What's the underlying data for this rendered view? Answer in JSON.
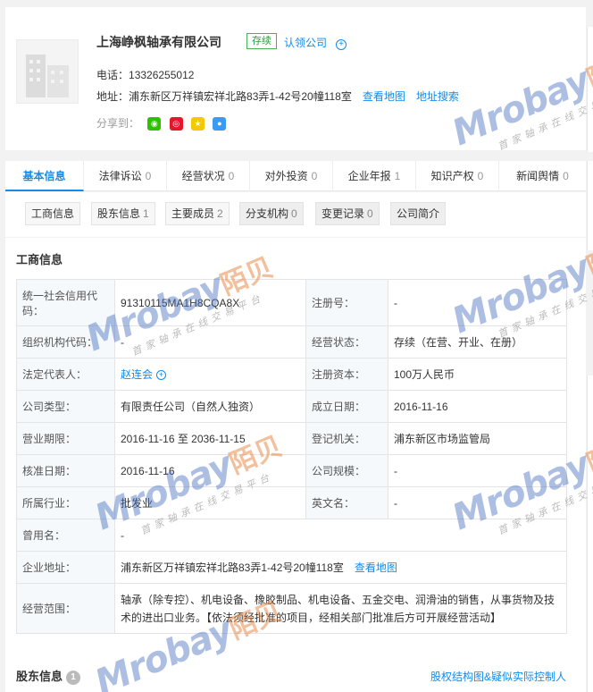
{
  "header": {
    "company_name": "上海峥枫轴承有限公司",
    "status": "存续",
    "claim": "认领公司",
    "phone_label": "电话：",
    "phone": "13326255012",
    "address_label": "地址：",
    "address": "浦东新区万祥镇宏祥北路83弄1-42号20幢118室",
    "view_map": "查看地图",
    "address_search": "地址搜索",
    "share_label": "分享到："
  },
  "tabs": [
    {
      "label": "基本信息",
      "count": ""
    },
    {
      "label": "法律诉讼",
      "count": "0"
    },
    {
      "label": "经营状况",
      "count": "0"
    },
    {
      "label": "对外投资",
      "count": "0"
    },
    {
      "label": "企业年报",
      "count": "1"
    },
    {
      "label": "知识产权",
      "count": "0"
    },
    {
      "label": "新闻舆情",
      "count": "0"
    }
  ],
  "subtabs": [
    {
      "label": "工商信息",
      "count": ""
    },
    {
      "label": "股东信息",
      "count": "1"
    },
    {
      "label": "主要成员",
      "count": "2"
    },
    {
      "label": "分支机构",
      "count": "0"
    },
    {
      "label": "变更记录",
      "count": "0"
    },
    {
      "label": "公司简介",
      "count": ""
    }
  ],
  "section_title": "工商信息",
  "table": {
    "credit_code_label": "统一社会信用代码：",
    "credit_code": "91310115MA1H8CQA8X",
    "reg_no_label": "注册号：",
    "reg_no": "-",
    "org_code_label": "组织机构代码：",
    "org_code": "-",
    "biz_status_label": "经营状态：",
    "biz_status": "存续（在营、开业、在册）",
    "legal_rep_label": "法定代表人：",
    "legal_rep": "赵连会",
    "reg_capital_label": "注册资本：",
    "reg_capital": "100万人民币",
    "company_type_label": "公司类型：",
    "company_type": "有限责任公司（自然人独资）",
    "found_date_label": "成立日期：",
    "found_date": "2016-11-16",
    "term_label": "营业期限：",
    "term": "2016-11-16 至 2036-11-15",
    "authority_label": "登记机关：",
    "authority": "浦东新区市场监管局",
    "approve_date_label": "核准日期：",
    "approve_date": "2016-11-16",
    "scale_label": "公司规模：",
    "scale": "-",
    "industry_label": "所属行业：",
    "industry": "批发业",
    "english_name_label": "英文名：",
    "english_name": "-",
    "former_name_label": "曾用名：",
    "former_name": "-",
    "address_label": "企业地址：",
    "address": "浦东新区万祥镇宏祥北路83弄1-42号20幢118室",
    "view_map": "查看地图",
    "scope_label": "经营范围：",
    "scope": "轴承（除专控）、机电设备、橡胶制品、机电设备、五金交电、润滑油的销售，从事货物及技术的进出口业务。【依法须经批准的项目，经相关部门批准后方可开展经营活动】"
  },
  "shareholder": {
    "title": "股东信息",
    "count": "1",
    "link": "股权结构图&疑似实际控制人"
  },
  "watermark": {
    "brand": "Mrobay",
    "brand_cn": "陌贝",
    "slogan": "首家轴承在线交易平台"
  },
  "colors": {
    "link": "#128bed",
    "status_green": "#2e9a3e",
    "wechat": "#2dc100",
    "weibo": "#e6162d",
    "qzone": "#f5c900",
    "qq": "#3a9bf0"
  }
}
